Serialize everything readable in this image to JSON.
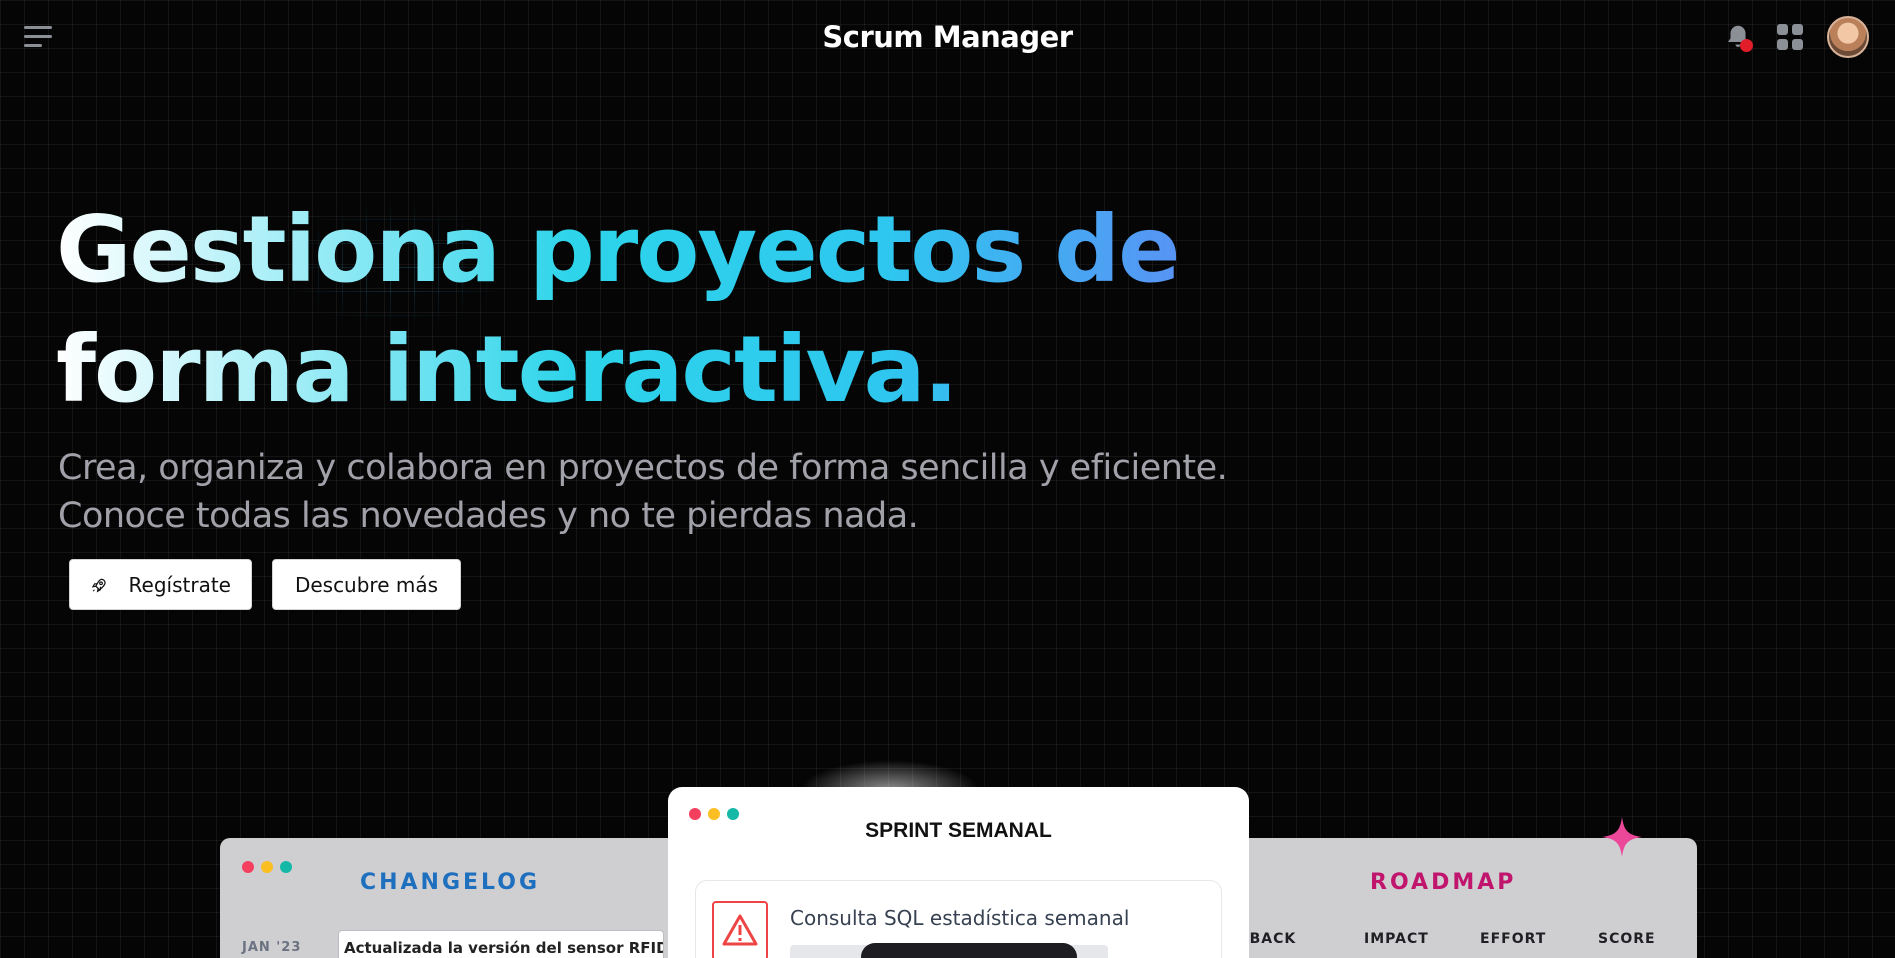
{
  "header": {
    "title": "Scrum Manager"
  },
  "hero": {
    "headline_line1": "Gestiona proyectos de",
    "headline_line2": "forma interactiva.",
    "subtitle_line1": "Crea, organiza y colabora en proyectos de forma sencilla y eficiente.",
    "subtitle_line2": "Conoce todas las novedades y no te pierdas nada."
  },
  "cta": {
    "register_label": "Regístrate",
    "discover_label": "Descubre más"
  },
  "changelog_card": {
    "title": "CHANGELOG",
    "date": "JAN '23",
    "entry": "Actualizada la versión del sensor RFID."
  },
  "sprint_card": {
    "title": "SPRINT SEMANAL",
    "task_title": "Consulta SQL estadística semanal"
  },
  "roadmap_card": {
    "title": "ROADMAP",
    "columns": [
      "DBACK",
      "IMPACT",
      "EFFORT",
      "SCORE"
    ]
  },
  "colors": {
    "background": "#050505",
    "notification_dot": "#e11d2a",
    "changelog_accent": "#1f6fbf",
    "roadmap_accent": "#c0146d",
    "sparkle": "#ec4899"
  },
  "icons": [
    "menu-icon",
    "bell-icon",
    "apps-grid-icon",
    "avatar",
    "rocket-icon",
    "alert-icon",
    "sparkle-icon"
  ]
}
